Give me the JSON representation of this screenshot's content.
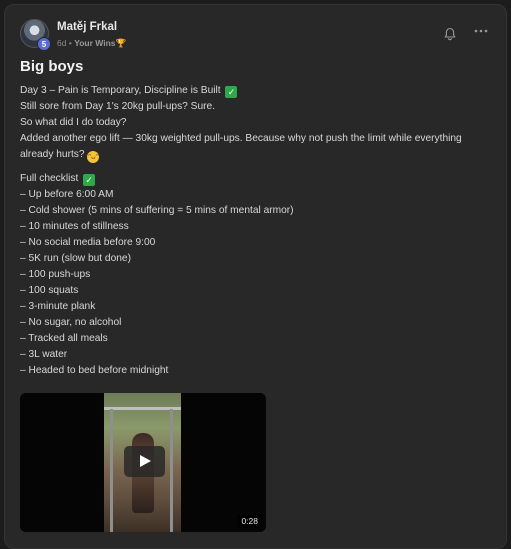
{
  "post": {
    "author": "Matěj Frkal",
    "level": "5",
    "time": "6d",
    "separator": "•",
    "category": "Your Wins",
    "category_emoji": "🏆",
    "title": "Big boys",
    "intro": [
      "Day 3 – Pain is Temporary, Discipline is Built",
      "Still sore from Day 1's 20kg pull-ups? Sure.",
      "So what did I do today?",
      "Added another ego lift — 30kg weighted pull-ups. Because why not push the limit while everything already hurts?"
    ],
    "checklist_title": "Full checklist",
    "checklist": [
      "– Up before 6:00 AM",
      "– Cold shower (5 mins of suffering = 5 mins of mental armor)",
      "– 10 minutes of stillness",
      "– No social media before 9:00",
      "– 5K run (slow but done)",
      "– 100 push-ups",
      "– 100 squats",
      "– 3-minute plank",
      "– No sugar, no alcohol",
      "– Tracked all meals",
      "– 3L water",
      "– Headed to bed before midnight"
    ],
    "video": {
      "duration": "0:28"
    }
  },
  "icons": {
    "check": "check-emoji-icon",
    "smile": "grinning-sweat-emoji-icon",
    "bell": "bell-icon",
    "more": "more-icon",
    "play": "play-icon"
  },
  "colors": {
    "background": "#1c1c1c",
    "card": "#282828",
    "level_badge": "#5b6cd4",
    "check_emoji": "#2fa84a"
  }
}
